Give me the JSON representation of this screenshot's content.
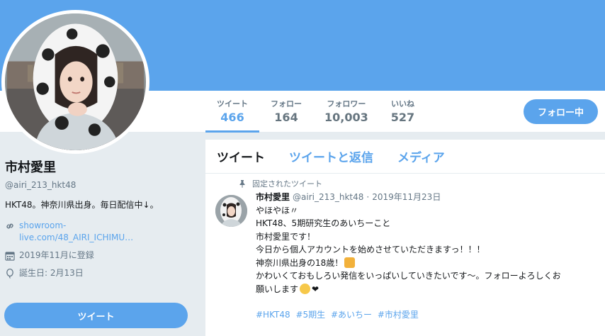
{
  "stats": [
    {
      "label": "ツイート",
      "value": "466",
      "active": true
    },
    {
      "label": "フォロー",
      "value": "164",
      "active": false
    },
    {
      "label": "フォロワー",
      "value": "10,003",
      "active": false
    },
    {
      "label": "いいね",
      "value": "527",
      "active": false
    }
  ],
  "follow_button": "フォロー中",
  "profile": {
    "name": "市村愛里",
    "handle": "@airi_213_hkt48",
    "bio": "HKT48。神奈川県出身。毎日配信中↓。",
    "link_line1": "showroom-",
    "link_line2": "live.com/48_AIRI_ICHIMU…",
    "joined": "2019年11月に登録",
    "birthday": "誕生日: 2月13日",
    "icons": {
      "link": "link-icon",
      "joined": "calendar-icon",
      "birthday": "balloon-icon"
    }
  },
  "tweet_button": "ツイート",
  "tabs": [
    "ツイート",
    "ツイートと返信",
    "メディア"
  ],
  "tweet": {
    "pinned_label": "固定されたツイート",
    "name": "市村愛里",
    "handle": "@airi_213_hkt48",
    "dot": "·",
    "date": "2019年11月23日",
    "lines": [
      "やほやほ〃",
      "HKT48、5期研究生のあいちーこと",
      "市村愛里です！",
      "今日から個人アカウントを始めさせていただきますっ！！！",
      "神奈川県出身の18歳！",
      "かわいくておもしろい発信をいっぱいしていきたいです～。フォローよろしくお",
      "願いします"
    ],
    "emoji_line5": "angry-face-emoji",
    "emoji_line7a": "smiling-face-emoji",
    "emoji_line7b": "❤",
    "hashtags": [
      "#HKT48",
      "#5期生",
      "#あいちー",
      "#市村愛里"
    ]
  },
  "colors": {
    "accent": "#5ba4ec",
    "background": "#e6ecf0",
    "text": "#14171a",
    "muted": "#657786"
  }
}
